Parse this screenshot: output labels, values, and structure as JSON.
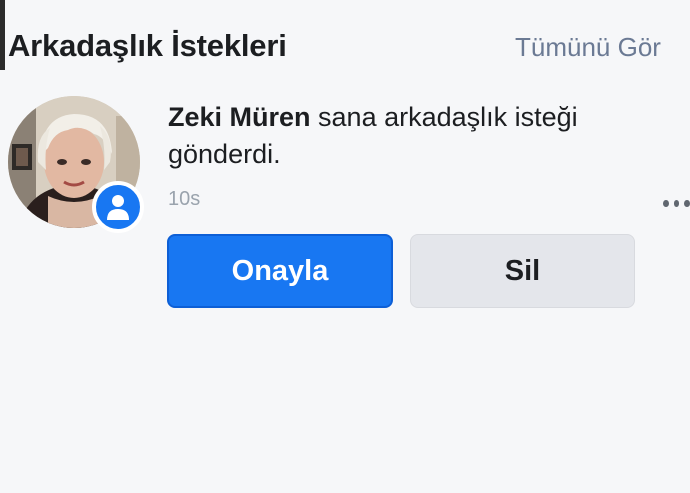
{
  "header": {
    "title": "Arkadaşlık İstekleri",
    "see_all": "Tümünü Gör"
  },
  "request": {
    "name": "Zeki Müren",
    "message": " sana arkadaşlık isteği gönderdi.",
    "time": "10s",
    "confirm_label": "Onayla",
    "delete_label": "Sil"
  },
  "colors": {
    "accent": "#1877f2",
    "secondary_button": "#e4e6eb",
    "muted_text": "#6b7a94"
  },
  "icons": {
    "badge": "person-icon",
    "menu": "more-dots-icon"
  }
}
